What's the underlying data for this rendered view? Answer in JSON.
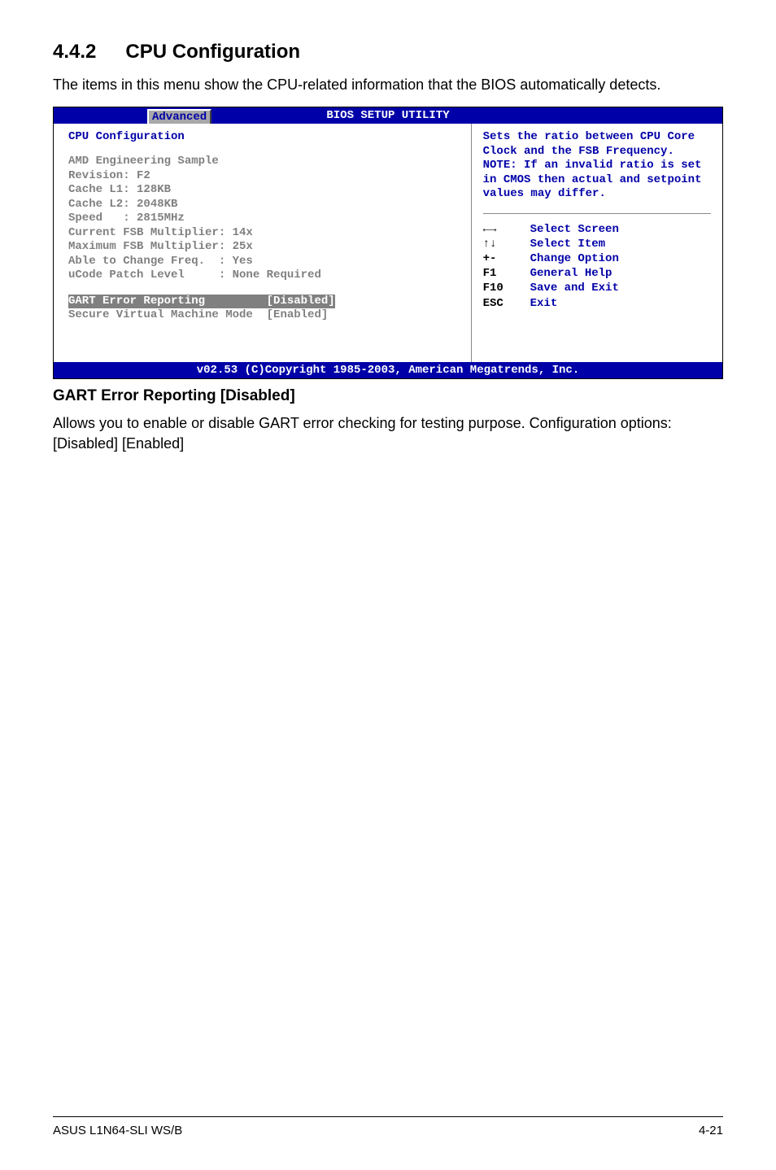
{
  "heading": {
    "number": "4.4.2",
    "title": "CPU Configuration"
  },
  "intro": "The items in this menu show the CPU-related information that the BIOS automatically detects.",
  "bios": {
    "title": "BIOS SETUP UTILITY",
    "tab": "Advanced",
    "config_title": "CPU Configuration",
    "lines": "AMD Engineering Sample\nRevision: F2\nCache L1: 128KB\nCache L2: 2048KB\nSpeed   : 2815MHz\nCurrent FSB Multiplier: 14x\nMaximum FSB Multiplier: 25x\nAble to Change Freq.  : Yes\nuCode Patch Level     : None Required",
    "selected_row": "GART Error Reporting         [Disabled]",
    "enabled_row": "Secure Virtual Machine Mode  [Enabled]",
    "help_text": "Sets the ratio between CPU Core Clock and the FSB Frequency.\nNOTE: If an invalid ratio is set in CMOS then actual and setpoint values may differ.",
    "keys": [
      {
        "k": "←→",
        "v": "Select Screen"
      },
      {
        "k": "↑↓",
        "v": "Select Item"
      },
      {
        "k": "+-",
        "v": "Change Option"
      },
      {
        "k": "F1",
        "v": "General Help"
      },
      {
        "k": "F10",
        "v": "Save and Exit"
      },
      {
        "k": "ESC",
        "v": "Exit"
      }
    ],
    "footer": "v02.53 (C)Copyright 1985-2003, American Megatrends, Inc."
  },
  "subheading": "GART Error Reporting [Disabled]",
  "body": "Allows you to enable or disable GART error checking for testing purpose. Configuration options: [Disabled] [Enabled]",
  "footer": {
    "left": "ASUS L1N64-SLI WS/B",
    "right": "4-21"
  }
}
